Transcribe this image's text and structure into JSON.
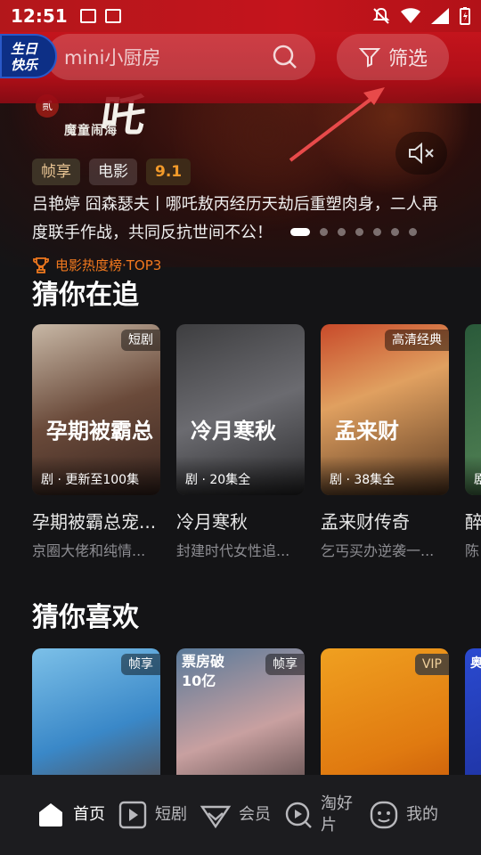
{
  "status": {
    "time": "12:51"
  },
  "header": {
    "birthday_badge": "生日\n快乐",
    "birthday_line1": "生日",
    "birthday_line2": "快乐",
    "search_placeholder": "mini小厨房",
    "filter_label": "筛选"
  },
  "hero": {
    "logo_big": "吒",
    "logo_sub": "魔童闹海",
    "logo_seal": "贰",
    "tags": [
      "帧享",
      "电影",
      "9.1"
    ],
    "description": "吕艳婷 囧森瑟夫丨哪吒敖丙经历天劫后重塑肉身，二人再度联手作战，共同反抗世间不公！",
    "rank_label": "电影热度榜·TOP3"
  },
  "sections": {
    "following_title": "猜你在追",
    "like_title": "猜你喜欢"
  },
  "following": [
    {
      "corner": "短剧",
      "overlay": "剧 · 更新至100集",
      "calli": "孕期被霸总",
      "title": "孕期被霸总宠...",
      "sub": "京圈大佬和纯情..."
    },
    {
      "corner": "",
      "overlay": "剧 · 20集全",
      "calli": "冷月寒秋",
      "title": "冷月寒秋",
      "sub": "封建时代女性追..."
    },
    {
      "corner": "高清经典",
      "overlay": "剧 · 38集全",
      "calli": "孟来财",
      "title": "孟来财传奇",
      "sub": "乞丐买办逆袭一..."
    },
    {
      "corner": "",
      "overlay": "剧",
      "calli": "",
      "title": "醉",
      "sub": "陈"
    }
  ],
  "likes": [
    {
      "corner": "帧享",
      "tl": ""
    },
    {
      "corner": "帧享",
      "tl": "票房破\n10亿"
    },
    {
      "corner": "VIP",
      "tl": ""
    },
    {
      "corner": "",
      "tl": "奥"
    }
  ],
  "likes_labels": {
    "q2_tl1": "票房破",
    "q2_tl2": "10亿",
    "q4_tl": "奥"
  },
  "nav": {
    "home": "首页",
    "shorts": "短剧",
    "vip": "会员",
    "shop": "淘好片",
    "mine": "我的"
  },
  "colors": {
    "accent": "#c4141c",
    "rank": "#f0781e",
    "score": "#f39a2a"
  }
}
